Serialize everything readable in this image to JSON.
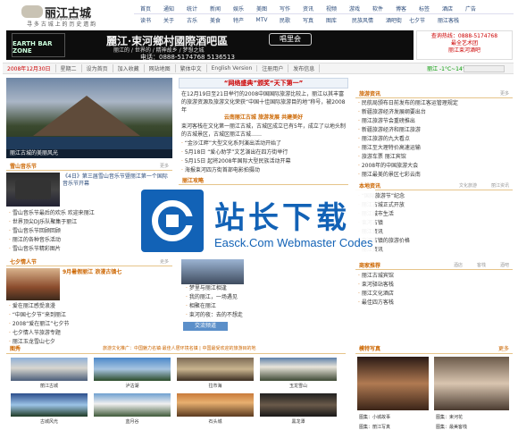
{
  "logo": {
    "title": "丽江古城",
    "sub": "www.ljdouban.com",
    "tagline": "寻 多 古 城 上 的 历 史 遗 韵"
  },
  "nav": {
    "row1": [
      "首页",
      "通知",
      "统计",
      "新闻",
      "娱乐",
      "美图",
      "写作",
      "资讯",
      "视频",
      "游戏",
      "软件",
      "博客",
      "标签",
      "酒店",
      "广告"
    ],
    "row2": [
      "读书",
      "关于",
      "古乐",
      "美食",
      "特产",
      "MTV",
      "民歌",
      "写真",
      "图库",
      "民族风情",
      "酒吧街",
      "七夕节",
      "丽江客栈"
    ]
  },
  "banner": {
    "emblem": "EARTH BAR ZONE",
    "title": "麗江·束河鄉村國際酒吧區",
    "badge": "唱里会",
    "sub": "丽江的 / 世界的 / 精神故乡 / 梦想之城",
    "phone": "电话：0888-5174768  5136513"
  },
  "side_ad": {
    "line1": "查询热线：0888-5174768",
    "line2": "最全艺术团",
    "line3": "丽江束河酒吧"
  },
  "infobar": {
    "date": "2008年12月30日",
    "weekday": "星期二",
    "items": [
      "设为首页",
      "加入收藏",
      "网站地图",
      "繁体中文",
      "English Version",
      "注册用户",
      "发布信息"
    ],
    "weather": "丽江 -1°C~14°C"
  },
  "slide": {
    "caption": "丽江古城的美丽风光"
  },
  "center": {
    "headline": "“网络盛典”颁奖“天下第一”",
    "body": "在12月19日至21日举行的2008中国国际旅游比较上，丽江以其丰富的旅游资源及旅游文化荣获“中国十佳国际旅游目的地”称号，被2008年",
    "sub": "云南丽江古城 旅游发展 共建美好",
    "body2": "束河客栈在文化第一丽江古城，古城区成立已有5年，成立了以地头制的古城景区，古城区丽江古城……",
    "list": [
      "“金沙江畔”大型文化系列演出活动开始了",
      "5月18日 “爱心助学”文艺演出在四方街举行",
      "5月15日 起将2008年国际大型民族活动开幕",
      "海报束河四方街首部电影拍摄动",
      "丽江的旅游事业与文化"
    ]
  },
  "music": {
    "title": "雪山音乐节",
    "more": "更多",
    "feature": "《4日》第三届雪山音乐节暨丽江第一个国际音乐节开幕",
    "list": [
      "雪山音乐节最后的欢乐 欢迎来丽江",
      "世界顶尖DJ乐队聚集于丽江",
      "雪山音乐节回顾回顾",
      "丽江的各种音乐活动",
      "雪山音乐节精彩图片"
    ]
  },
  "qixi": {
    "title": "七夕情人节",
    "more": "更多",
    "feature": "9月暑假丽江 浪漫古镇七",
    "list": [
      "爱在丽江感受浪漫",
      "“中国七夕节”来到丽江",
      "2008“爱在丽江”七夕节",
      "七夕情人节旅游专题",
      "丽江玉龙雪山七夕"
    ]
  },
  "right_news": {
    "title": "旅游资讯",
    "more": "更多",
    "list": [
      "民航局颁布日前发布的丽江客运管理规定",
      "新疆旅游经济发展纲要出台",
      "丽江旅游节会重磅推出",
      "新疆旅游经济和丽江旅游",
      "丽江旅游的九大看点",
      "丽江至大理特价高速运输",
      "旅游车票 丽江宾馆",
      "2008年的中国旅游大会",
      "丽江最美的景区七彩云南",
      "中国丽江旅游发展研究"
    ]
  },
  "right_local": {
    "title": "本地资讯",
    "tabs": [
      "文化旅游",
      "丽江资讯"
    ],
    "list": [
      "“国际旅游节”纪念",
      "丽江古城正式开放",
      "丽江城市生活",
      "束河古镇",
      "丽江资讯",
      "束河古镇的旅游价格"
    ]
  },
  "right_biz": {
    "title": "商家推荐",
    "tabs": [
      "酒店",
      "客栈",
      "酒吧"
    ],
    "list": [
      "丽江古城宾馆",
      "束河驿站客栈",
      "丽江文化酒店",
      "最佳四方客栈"
    ]
  },
  "center_bottom": {
    "title": "丽江攻略",
    "list": [
      "梦里与丽江相逢",
      "我的丽江，一场遇见",
      "相聚在丽江",
      "束河的夜：去的不想走"
    ],
    "link": "交流频道"
  },
  "gallery": {
    "title": "图秀",
    "sub": "旅游文化推广：中国魅力名镇·最佳人居环境名镇 | 中国最受欢迎的旅游目的地",
    "captions": [
      "丽江古城",
      "泸沽湖",
      "拉市海",
      "玉龙雪山",
      "古城风光",
      "蓝月谷",
      "石头城",
      "黑龙潭"
    ]
  },
  "portrait": {
    "title": "模特写真",
    "more": "更多",
    "captions": [
      "图集：小城故事",
      "图集：丽江写真",
      "图集：束河花",
      "图集：最美客栈"
    ]
  },
  "watermark": {
    "big": "站长下载",
    "small": "Easck.Com Webmaster Codes"
  },
  "colors": {
    "accent": "#c66600",
    "link": "#2a4a7a",
    "brand": "#1262b6"
  }
}
